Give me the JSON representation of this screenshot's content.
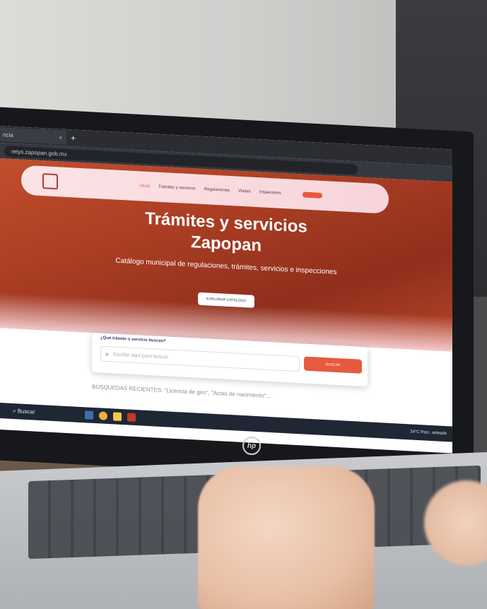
{
  "browser": {
    "tab_title": "ncia",
    "tab_close": "×",
    "new_tab": "+",
    "url": "retys.zapopan.gob.mx"
  },
  "nav": {
    "links": [
      "Inicio",
      "Trámites y servicios",
      "Regulaciones",
      "Visitas",
      "Inspectores"
    ]
  },
  "hero": {
    "title_line1": "Trámites y servicios",
    "title_line2": "Zapopan",
    "subtitle": "Catálogo municipal de regulaciones, trámites, servicios e inspecciones",
    "explore_button": "EXPLORAR CATÁLOGO"
  },
  "search": {
    "question": "¿Qué trámite o servicio buscas?",
    "placeholder": "Escribe aquí para buscar",
    "button": "BUSCAR",
    "recent": "BÚSQUEDAS RECIENTES: \"Licencia de giro\", \"Actas de nacimiento\"..."
  },
  "taskbar": {
    "search_label": "Buscar",
    "weather": "24°C Parc. soleado"
  },
  "brand": {
    "laptop_logo": "hp"
  },
  "colors": {
    "accent": "#e65a3f",
    "hero": "#a83c23",
    "taskbar": "#1e2733"
  }
}
